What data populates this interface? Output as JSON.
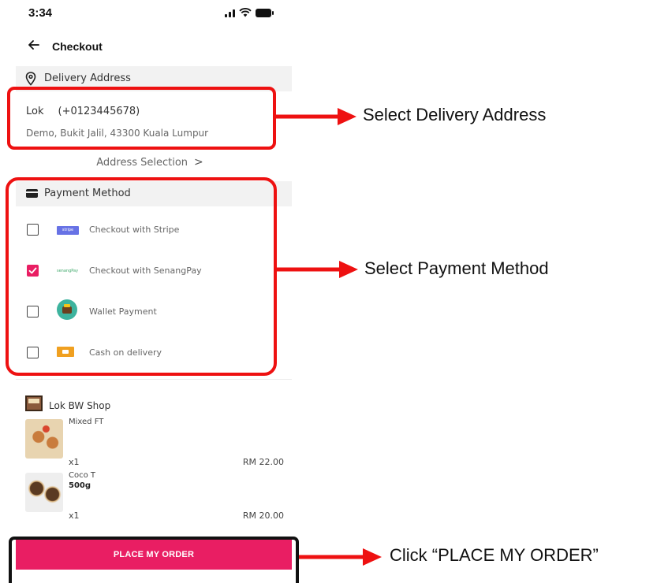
{
  "status_bar": {
    "time": "3:34"
  },
  "nav": {
    "title": "Checkout"
  },
  "delivery": {
    "header": "Delivery Address",
    "name": "Lok",
    "phone": "(+0123445678)",
    "address": "Demo, Bukit Jalil, 43300 Kuala Lumpur",
    "selection_link": "Address Selection",
    "selection_chevron": ">"
  },
  "payment": {
    "header": "Payment Method",
    "options": [
      {
        "label": "Checkout with Stripe",
        "logo_text": "stripe",
        "checked": false,
        "icon": "stripe-logo"
      },
      {
        "label": "Checkout with SenangPay",
        "logo_text": "senangPay",
        "checked": true,
        "icon": "senangpay-logo"
      },
      {
        "label": "Wallet Payment",
        "checked": false,
        "icon": "wallet-icon"
      },
      {
        "label": "Cash on delivery",
        "checked": false,
        "icon": "cash-delivery-icon"
      }
    ]
  },
  "shop": {
    "name": "Lok BW Shop",
    "items": [
      {
        "name": "Mixed FT",
        "variant": "",
        "qty": "x1",
        "price": "RM 22.00"
      },
      {
        "name": "Coco T",
        "variant": "500g",
        "qty": "x1",
        "price": "RM 20.00"
      }
    ]
  },
  "order": {
    "button_label": "PLACE MY ORDER"
  },
  "annotations": {
    "address": "Select Delivery Address",
    "payment": "Select Payment Method",
    "order": "Click “PLACE MY ORDER”"
  },
  "colors": {
    "accent": "#e91e63",
    "annotation_red": "#ee1111",
    "annotation_black": "#111111",
    "section_bg": "#f2f2f2"
  }
}
